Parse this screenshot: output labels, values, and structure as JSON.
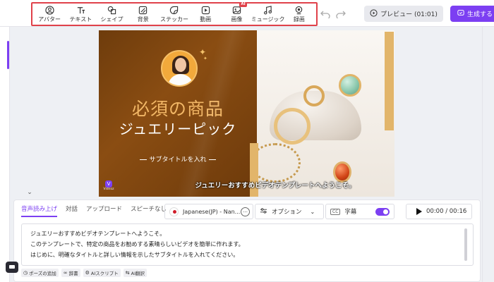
{
  "toolbar": {
    "tools": [
      {
        "label": "アバター",
        "icon": "avatar-icon"
      },
      {
        "label": "テキスト",
        "icon": "text-icon"
      },
      {
        "label": "シェイプ",
        "icon": "shape-icon"
      },
      {
        "label": "背景",
        "icon": "background-icon"
      },
      {
        "label": "ステッカー",
        "icon": "sticker-icon"
      },
      {
        "label": "動画",
        "icon": "video-icon"
      },
      {
        "label": "画像",
        "icon": "image-icon",
        "badge": "AI"
      },
      {
        "label": "ミュージック",
        "icon": "music-icon"
      },
      {
        "label": "録画",
        "icon": "record-icon"
      }
    ],
    "preview_label": "プレビュー (01:01)",
    "generate_label": "生成する"
  },
  "canvas": {
    "title_line1": "必須の商品",
    "title_line2": "ジュエリーピック",
    "subtitle": "サブタイトルを入れ",
    "caption": "ジュエリーおすすめビデオテンプレートへようこそ。",
    "logo_text": "Vidnoz",
    "colors": {
      "brown": "#7a4410",
      "gold": "#e2b56a",
      "title_gold": "#f2b766"
    }
  },
  "panel": {
    "tabs": [
      "音声読み上げ",
      "対話",
      "アップロード",
      "スピーチなし"
    ],
    "active_tab": 0,
    "language": "Japanese(JP) - Nan...",
    "options_label": "オプション",
    "subtitles_label": "字幕",
    "subtitles_cc": "CC",
    "subtitles_on": true,
    "time": "00:00 / 00:16",
    "script_lines": [
      "ジュエリーおすすめビデオテンプレートへようこそ。",
      "このテンプレートで、特定の商品をお勧めする素晴らしいビデオを簡単に作れます。",
      "はじめに、明確なタイトルと詳しい情報を示したサブタイトルを入れてください。"
    ],
    "actions": [
      "ポーズの追加",
      "辞書",
      "AIスクリプト",
      "AI翻訳"
    ]
  },
  "accent": "#7c3ff2"
}
